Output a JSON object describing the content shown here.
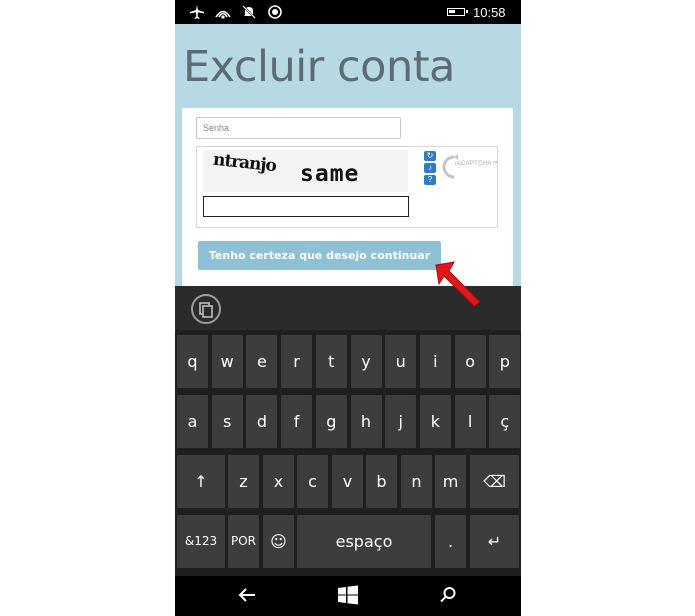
{
  "status_bar": {
    "time": "10:58",
    "icons": [
      "airplane-icon",
      "wifi-icon",
      "quiet-hours-icon",
      "location-icon",
      "battery-icon"
    ]
  },
  "page": {
    "title": "Excluir conta",
    "password_placeholder": "Senha",
    "captcha": {
      "word1": "ntranjo",
      "word2": "same",
      "buttons": [
        "refresh-icon",
        "audio-icon",
        "help-icon"
      ],
      "logo_text": "reCAPTCHA™"
    },
    "confirm_button": "Tenho certeza que desejo continuar"
  },
  "keyboard": {
    "row1": [
      "q",
      "w",
      "e",
      "r",
      "t",
      "y",
      "u",
      "i",
      "o",
      "p"
    ],
    "row2": [
      "a",
      "s",
      "d",
      "f",
      "g",
      "h",
      "j",
      "k",
      "l",
      "ç"
    ],
    "row3": [
      "↑",
      "z",
      "x",
      "c",
      "v",
      "b",
      "n",
      "m",
      "⌫"
    ],
    "row4": {
      "symbols": "&123",
      "language": "POR",
      "emoji": "☺",
      "space": "espaço",
      "period": ".",
      "enter": "↵"
    }
  },
  "colors": {
    "page_bg": "#b7d9e4",
    "title": "#5d6b72",
    "button": "#8fc0d5",
    "key_bg": "#3d3d3d",
    "keyboard_bg": "#1f1f1f",
    "annotation_arrow": "#e0181b"
  }
}
